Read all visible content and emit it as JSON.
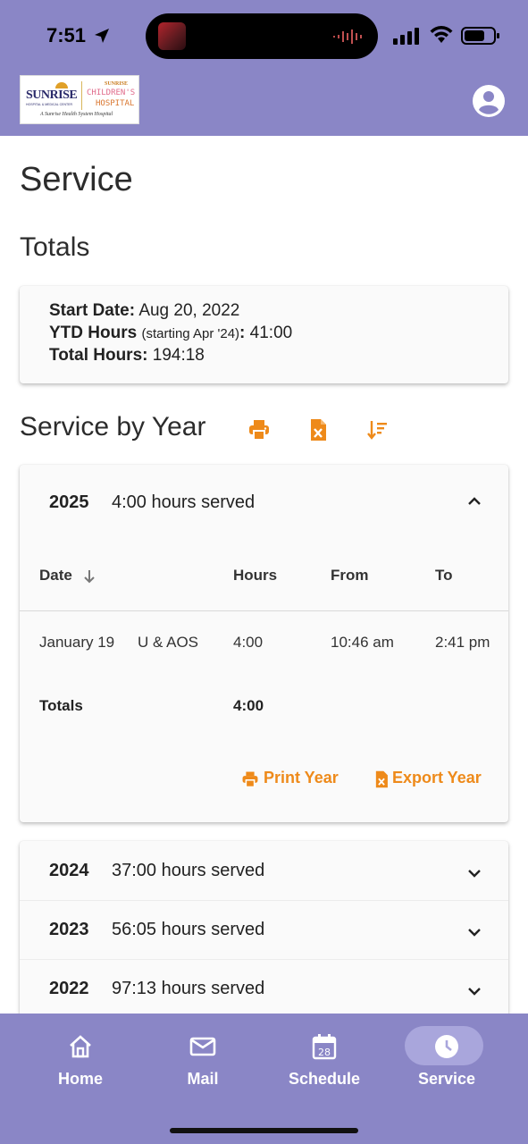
{
  "status_bar": {
    "time": "7:51"
  },
  "header": {
    "logo": {
      "left": "SUNRISE",
      "left_sub": "HOSPITAL & MEDICAL CENTER",
      "right_top": "SUNRISE",
      "right_mid": "CHILDREN'S",
      "right_bot": "HOSPITAL",
      "tagline": "A Sunrise Health System Hospital"
    }
  },
  "page": {
    "title": "Service"
  },
  "totals": {
    "heading": "Totals",
    "start_label": "Start Date:",
    "start_value": "Aug 20, 2022",
    "ytd_label": "YTD Hours",
    "ytd_note": "(starting Apr '24)",
    "ytd_colon": ":",
    "ytd_value": "41:00",
    "total_label": "Total Hours:",
    "total_value": "194:18"
  },
  "service_by_year": {
    "heading": "Service by Year",
    "expanded": {
      "year": "2025",
      "hours": "4:00 hours served",
      "columns": {
        "date": "Date",
        "hours": "Hours",
        "from": "From",
        "to": "To"
      },
      "rows": [
        {
          "date": "January 19",
          "dept": "U & AOS",
          "hours": "4:00",
          "from": "10:46 am",
          "to": "2:41 pm"
        }
      ],
      "totals_label": "Totals",
      "totals_hours": "4:00",
      "print_label": "Print Year",
      "export_label": "Export Year"
    },
    "collapsed": [
      {
        "year": "2024",
        "hours": "37:00 hours served"
      },
      {
        "year": "2023",
        "hours": "56:05 hours served"
      },
      {
        "year": "2022",
        "hours": "97:13 hours served"
      }
    ]
  },
  "nav": {
    "home": "Home",
    "mail": "Mail",
    "schedule": "Schedule",
    "schedule_day": "28",
    "service": "Service"
  },
  "colors": {
    "header": "#8a86c6",
    "accent": "#ee8a1a"
  }
}
